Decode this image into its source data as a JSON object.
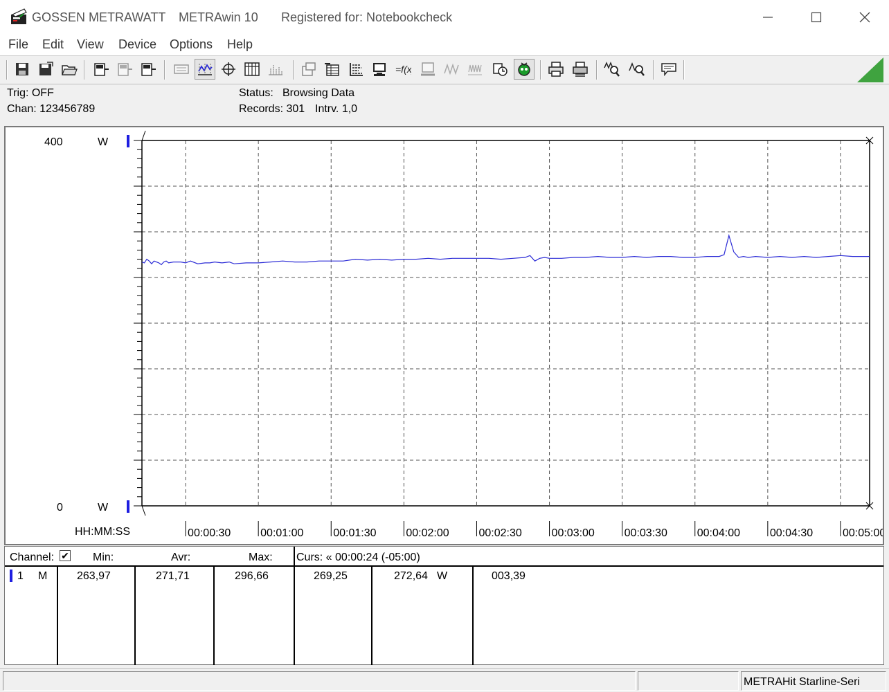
{
  "window": {
    "brand": "GOSSEN METRAWATT",
    "product": "METRAwin 10",
    "registration": "Registered for: Notebookcheck",
    "minimize_icon": "minimize-icon",
    "maximize_icon": "maximize-icon",
    "close_icon": "close-icon"
  },
  "menu": [
    "File",
    "Edit",
    "View",
    "Device",
    "Options",
    "Help"
  ],
  "toolbar": {
    "icons": [
      "save-icon",
      "save-as-icon",
      "open-folder-icon",
      "device-read-icon",
      "device-disabled-icon",
      "device-write-icon",
      "memory-disabled-icon",
      "trend-mode-icon",
      "crosshair-cursor-icon",
      "table-icon",
      "histogram-disabled-icon",
      "export-disabled-icon",
      "export-table-icon",
      "settings-grid-icon",
      "monitor-icon",
      "formula-icon",
      "print-disabled-icon",
      "scope-disabled-icon",
      "wave-disabled-icon",
      "record-icon",
      "online-icon",
      "printer-icon",
      "print-preview-icon",
      "zoom-auto-icon",
      "zoom-cursor-icon",
      "comment-icon",
      "status-triangle-icon"
    ]
  },
  "status": {
    "trig": "Trig: OFF",
    "chan": "Chan:  123456789",
    "status_label": "Status:",
    "status_value": "Browsing Data",
    "records": "Records: 301",
    "interval": "Intrv. 1,0"
  },
  "chart_data": {
    "type": "line",
    "ylim": [
      0,
      400
    ],
    "y_top_label": "400",
    "y_bottom_label": "0",
    "y_unit": "W",
    "x_axis_format": "HH:MM:SS",
    "xlim_seconds": [
      12,
      312
    ],
    "x_tick_labels": [
      "00:00:30",
      "00:01:00",
      "00:01:30",
      "00:02:00",
      "00:02:30",
      "00:03:00",
      "00:03:30",
      "00:04:00",
      "00:04:30",
      "00:05:00"
    ],
    "line_color": "#2b2bd6",
    "grid": true,
    "series": [
      {
        "x": [
          12,
          13,
          14,
          15,
          16,
          17,
          18,
          19,
          20,
          21,
          22,
          23,
          25,
          28,
          30,
          32,
          35,
          38,
          40,
          42,
          45,
          48,
          50,
          55,
          60,
          65,
          70,
          75,
          80,
          85,
          90,
          95,
          100,
          105,
          110,
          115,
          120,
          125,
          130,
          135,
          140,
          145,
          150,
          155,
          160,
          165,
          170,
          172,
          174,
          176,
          178,
          180,
          182,
          185,
          190,
          195,
          200,
          205,
          210,
          215,
          220,
          225,
          230,
          235,
          240,
          245,
          250,
          252,
          254,
          256,
          258,
          260,
          262,
          265,
          270,
          275,
          280,
          285,
          290,
          295,
          300,
          305,
          310,
          312
        ],
        "y": [
          267,
          266,
          270,
          268,
          265,
          268,
          267,
          266,
          264,
          267,
          268,
          266,
          267,
          267,
          266,
          268,
          265,
          266,
          266,
          267,
          266,
          267,
          265,
          266,
          266,
          267,
          268,
          267,
          267,
          268,
          268,
          268,
          270,
          269,
          270,
          269,
          270,
          270,
          271,
          270,
          271,
          271,
          271,
          271,
          270,
          271,
          272,
          274,
          268,
          271,
          272,
          271,
          271,
          271,
          272,
          272,
          273,
          272,
          272,
          273,
          272,
          273,
          273,
          272,
          272,
          273,
          273,
          275,
          296,
          278,
          272,
          273,
          272,
          273,
          272,
          273,
          272,
          273,
          272,
          273,
          274,
          273,
          273,
          273
        ]
      }
    ]
  },
  "table": {
    "headers": {
      "channel": "Channel:",
      "min": "Min:",
      "avr": "Avr:",
      "max": "Max:",
      "cursor": "Curs: « 00:00:24 (-05:00)"
    },
    "row": {
      "num": "1",
      "mode": "M",
      "min": "263,97",
      "avr": "271,71",
      "max": "296,66",
      "c1": "269,25",
      "c2": "272,64",
      "unit": "W",
      "diff": "003,39"
    }
  },
  "statusbar": {
    "device": "METRAHit Starline-Seri"
  }
}
